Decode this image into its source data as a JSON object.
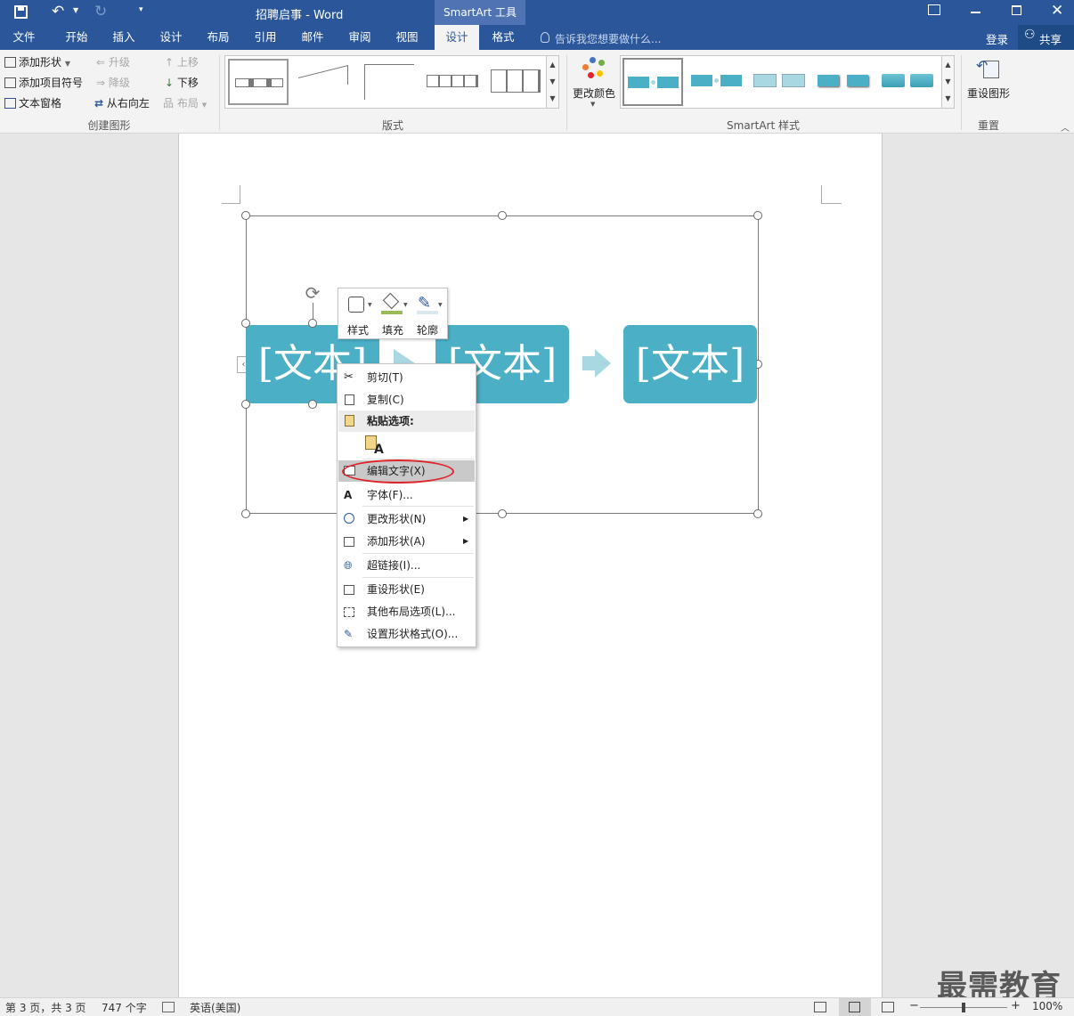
{
  "window": {
    "title": "招聘启事 - Word",
    "context_tab": "SmartArt 工具"
  },
  "tabs": [
    "文件",
    "开始",
    "插入",
    "设计",
    "布局",
    "引用",
    "邮件",
    "审阅",
    "视图",
    "设计",
    "格式"
  ],
  "tell_me": "告诉我您想要做什么...",
  "signin": "登录",
  "share": "共享",
  "ribbon": {
    "create_group": {
      "label": "创建图形",
      "add_shape": "添加形状",
      "add_bullet": "添加项目符号",
      "text_pane": "文本窗格",
      "promote": "升级",
      "demote": "降级",
      "rtl": "从右向左",
      "move_up": "上移",
      "move_down": "下移",
      "layout": "布局"
    },
    "layouts_label": "版式",
    "change_colors": "更改颜色",
    "styles_label": "SmartArt 样式",
    "reset_graphic": "重设图形",
    "reset_label": "重置"
  },
  "smartart": {
    "boxes": [
      "[文本]",
      "[文本]",
      "[文本]"
    ]
  },
  "mini_toolbar": {
    "style": "样式",
    "fill": "填充",
    "outline": "轮廓"
  },
  "context_menu": {
    "cut": "剪切(T)",
    "copy": "复制(C)",
    "paste_options": "粘贴选项:",
    "edit_text": "编辑文字(X)",
    "font": "字体(F)...",
    "change_shape": "更改形状(N)",
    "add_shape": "添加形状(A)",
    "hyperlink": "超链接(I)...",
    "reset_shape": "重设形状(E)",
    "more_layout": "其他布局选项(L)...",
    "format_shape": "设置形状格式(O)..."
  },
  "status": {
    "page": "第 3 页，共 3 页",
    "words": "747 个字",
    "language": "英语(美国)",
    "zoom": "100%",
    "zoom_level": 1.0
  },
  "watermark": "最需教育",
  "colors": {
    "accent": "#2b579a",
    "shape": "#4bafc5",
    "arrow": "#a9d8e2",
    "highlight": "#e0242b"
  }
}
